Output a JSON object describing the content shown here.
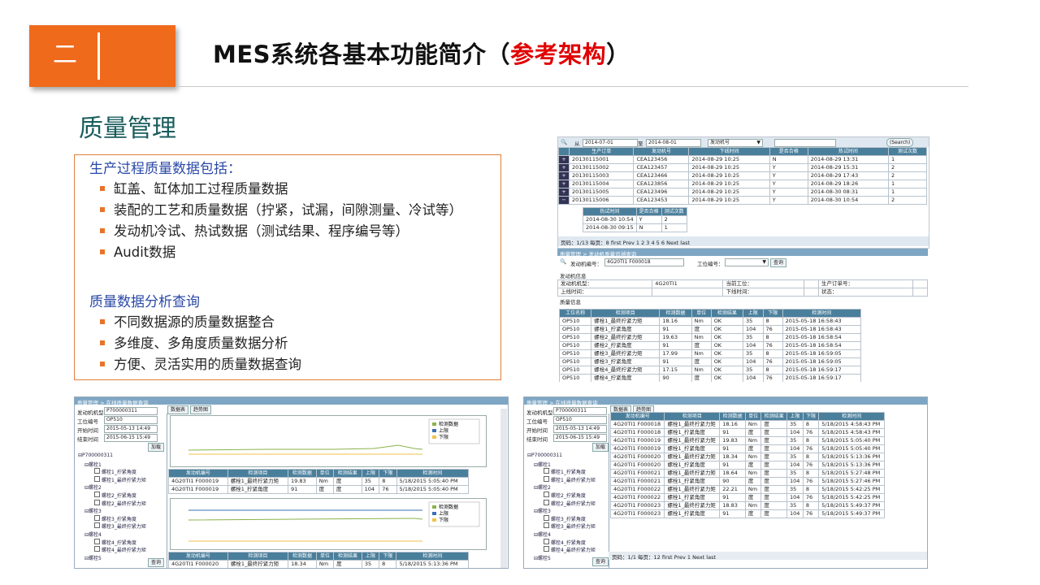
{
  "section": {
    "number": "二"
  },
  "title": {
    "main": "MES系统各基本功能简介（",
    "highlight": "参考架构",
    "close": "）"
  },
  "subtitle": "质量管理",
  "box": {
    "heading1": "生产过程质量数据包括：",
    "items1": [
      "缸盖、缸体加工过程质量数据",
      "装配的工艺和质量数据（拧紧，试漏，间隙测量、冷试等）",
      "发动机冷试、热试数据（测试结果、程序编号等）",
      "Audit数据"
    ],
    "heading2": "质量数据分析查询",
    "items2": [
      "不同数据源的质量数据整合",
      "多维度、多角度质量数据分析",
      "方便、灵活实用的质量数据查询"
    ]
  },
  "shot1": {
    "from_label": "从",
    "from_value": "2014-07-01",
    "to_label": "至",
    "to_value": "2014-08-01",
    "select_value": "发动机号",
    "search_button": "(Search)",
    "headers": [
      "生产订单",
      "发动机号",
      "下线时间",
      "是否合格",
      "热试时间",
      "测试次数"
    ],
    "rows": [
      [
        "20130115001",
        "CEA123456",
        "2014-08-29 10:25",
        "N",
        "2014-08-29 13:31",
        "1"
      ],
      [
        "20130115002",
        "CEA123457",
        "2014-08-29 10:25",
        "Y",
        "2014-08-29 15:31",
        "2"
      ],
      [
        "20130115003",
        "CEA123466",
        "2014-08-29 10:25",
        "Y",
        "2014-08-29 17:43",
        "2"
      ],
      [
        "20130115004",
        "CEA123856",
        "2014-08-29 10:25",
        "Y",
        "2014-08-29 18:26",
        "1"
      ],
      [
        "20130115005",
        "CEA123496",
        "2014-08-29 10:25",
        "Y",
        "2014-08-30 08:31",
        "1"
      ],
      [
        "20130115006",
        "CEA123453",
        "2014-08-29 10:25",
        "Y",
        "2014-08-30 10:54",
        "2"
      ]
    ],
    "sub_headers": [
      "热试时间",
      "是否合格",
      "测试次数"
    ],
    "sub_rows": [
      [
        "2014-08-30 10:54",
        "Y",
        "2"
      ],
      [
        "2014-08-30 09:15",
        "N",
        "1"
      ]
    ],
    "pager": "页码：1/13 每页：8 first Prev 1 2 3 4 5 6 Next last"
  },
  "shot2": {
    "breadcrumb": "质量管理 > 发动机质量追溯查询",
    "engine_label": "发动机编号：",
    "engine_value": "4G20TI1 F000018",
    "station_label": "工位编号：",
    "query_button": "查询",
    "engine_info": "发动机信息",
    "info_rows": [
      [
        "发动机机型：",
        "4G20TI1",
        "当前工位：",
        "",
        "生产订单号：",
        ""
      ],
      [
        "上线时间：",
        "",
        "下线时间：",
        "",
        "状态：",
        ""
      ]
    ],
    "quality_info": "质量信息",
    "headers": [
      "工位名称",
      "检测项目",
      "检测数据",
      "单位",
      "检测结果",
      "上限",
      "下限",
      "检测时间"
    ],
    "rows": [
      [
        "OP510",
        "螺栓1_最终拧紧力矩",
        "18.16",
        "Nm",
        "OK",
        "35",
        "8",
        "2015-05-18 16:58:43"
      ],
      [
        "OP510",
        "螺栓1_拧紧角度",
        "91",
        "度",
        "OK",
        "104",
        "76",
        "2015-05-18 16:58:43"
      ],
      [
        "OP510",
        "螺栓2_最终拧紧力矩",
        "19.63",
        "Nm",
        "OK",
        "35",
        "8",
        "2015-05-18 16:58:54"
      ],
      [
        "OP510",
        "螺栓2_拧紧角度",
        "91",
        "度",
        "OK",
        "104",
        "76",
        "2015-05-18 16:58:54"
      ],
      [
        "OP510",
        "螺栓3_最终拧紧力矩",
        "17.99",
        "Nm",
        "OK",
        "35",
        "8",
        "2015-05-18 16:59:05"
      ],
      [
        "OP510",
        "螺栓3_拧紧角度",
        "91",
        "度",
        "OK",
        "104",
        "76",
        "2015-05-18 16:59:05"
      ],
      [
        "OP510",
        "螺栓4_最终拧紧力矩",
        "17.15",
        "Nm",
        "OK",
        "35",
        "8",
        "2015-05-18 16:59:17"
      ],
      [
        "OP510",
        "螺栓4_拧紧角度",
        "90",
        "度",
        "OK",
        "104",
        "76",
        "2015-05-18 16:59:17"
      ]
    ]
  },
  "shot3": {
    "breadcrumb": "质量管理 > 在线质量数据查询",
    "fields": [
      [
        "发动机机型号",
        "P700000311"
      ],
      [
        "工位编号",
        "OP510"
      ],
      [
        "开始时间",
        "2015-05-13 14:49"
      ],
      [
        "结束时间",
        "2015-06-15 15:49"
      ]
    ],
    "load_button": "加载",
    "query_button": "查询",
    "tabs": [
      "数据表",
      "趋势图"
    ],
    "tree": [
      "P700000311",
      "螺栓1",
      "螺栓1_拧紧角度",
      "螺栓1_最终拧紧力矩",
      "螺栓2",
      "螺栓2_拧紧角度",
      "螺栓2_最终拧紧力矩",
      "螺栓3",
      "螺栓3_拧紧角度",
      "螺栓3_最终拧紧力矩",
      "螺栓4",
      "螺栓4_拧紧角度",
      "螺栓4_最终拧紧力矩",
      "螺栓5"
    ],
    "legend": [
      "检测数据",
      "上限",
      "下限"
    ],
    "headers": [
      "发动机编号",
      "检测项目",
      "检测数据",
      "单位",
      "检测结果",
      "上限",
      "下限",
      "检测时间"
    ],
    "rows1": [
      [
        "4G20TI1 F000019",
        "螺栓1_最终拧紧力矩",
        "19.83",
        "Nm",
        "度",
        "35",
        "8",
        "5/18/2015 5:05:40 PM"
      ],
      [
        "4G20TI1 F000019",
        "螺栓1_拧紧角度",
        "91",
        "度",
        "度",
        "104",
        "76",
        "5/18/2015 5:05:40 PM"
      ]
    ],
    "rows2": [
      [
        "4G20TI1 F000020",
        "螺栓1_最终拧紧力矩",
        "18.34",
        "Nm",
        "度",
        "35",
        "8",
        "5/18/2015 5:13:36 PM"
      ]
    ]
  },
  "shot4": {
    "breadcrumb": "质量管理 > 在线质量数据查询",
    "fields": [
      [
        "发动机机型号",
        "P700000311"
      ],
      [
        "工位编号",
        "OP510"
      ],
      [
        "开始时间",
        "2015-05-13 14:49"
      ],
      [
        "结束时间",
        "2015-06-15 15:49"
      ]
    ],
    "load_button": "加载",
    "query_button": "查询",
    "tabs": [
      "数据表",
      "趋势图"
    ],
    "tree": [
      "P700000311",
      "螺栓1",
      "螺栓1_拧紧角度",
      "螺栓1_最终拧紧力矩",
      "螺栓2",
      "螺栓2_拧紧角度",
      "螺栓2_最终拧紧力矩",
      "螺栓3",
      "螺栓3_拧紧角度",
      "螺栓3_最终拧紧力矩",
      "螺栓4",
      "螺栓4_拧紧角度",
      "螺栓4_最终拧紧力矩",
      "螺栓5"
    ],
    "headers": [
      "发动机编号",
      "检测项目",
      "检测数据",
      "单位",
      "检测结果",
      "上限",
      "下限",
      "检测时间"
    ],
    "rows": [
      [
        "4G20TI1 F000018",
        "螺栓1_最终拧紧力矩",
        "18.16",
        "Nm",
        "度",
        "35",
        "8",
        "5/18/2015 4:58:43 PM"
      ],
      [
        "4G20TI1 F000018",
        "螺栓1_拧紧角度",
        "91",
        "度",
        "度",
        "104",
        "76",
        "5/18/2015 4:58:43 PM"
      ],
      [
        "4G20TI1 F000019",
        "螺栓1_最终拧紧力矩",
        "19.83",
        "Nm",
        "度",
        "35",
        "8",
        "5/18/2015 5:05:40 PM"
      ],
      [
        "4G20TI1 F000019",
        "螺栓1_拧紧角度",
        "91",
        "度",
        "度",
        "104",
        "76",
        "5/18/2015 5:05:40 PM"
      ],
      [
        "4G20TI1 F000020",
        "螺栓1_最终拧紧力矩",
        "18.34",
        "Nm",
        "度",
        "35",
        "8",
        "5/18/2015 5:13:36 PM"
      ],
      [
        "4G20TI1 F000020",
        "螺栓1_拧紧角度",
        "91",
        "度",
        "度",
        "104",
        "76",
        "5/18/2015 5:13:36 PM"
      ],
      [
        "4G20TI1 F000021",
        "螺栓1_最终拧紧力矩",
        "18.64",
        "Nm",
        "度",
        "35",
        "8",
        "5/18/2015 5:27:48 PM"
      ],
      [
        "4G20TI1 F000021",
        "螺栓1_拧紧角度",
        "90",
        "度",
        "度",
        "104",
        "76",
        "5/18/2015 5:27:46 PM"
      ],
      [
        "4G20TI1 F000022",
        "螺栓1_最终拧紧力矩",
        "22.21",
        "Nm",
        "度",
        "35",
        "8",
        "5/18/2015 5:42:25 PM"
      ],
      [
        "4G20TI1 F000022",
        "螺栓1_拧紧角度",
        "91",
        "度",
        "度",
        "104",
        "76",
        "5/18/2015 5:42:25 PM"
      ],
      [
        "4G20TI1 F000023",
        "螺栓1_最终拧紧力矩",
        "18.83",
        "Nm",
        "度",
        "35",
        "8",
        "5/18/2015 5:49:37 PM"
      ],
      [
        "4G20TI1 F000023",
        "螺栓1_拧紧角度",
        "91",
        "度",
        "度",
        "104",
        "76",
        "5/18/2015 5:49:37 PM"
      ]
    ],
    "pager": "页码：1/1 每页：12 first Prev 1 Next last"
  }
}
